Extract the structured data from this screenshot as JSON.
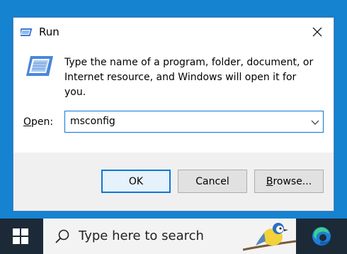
{
  "dialog": {
    "title": "Run",
    "description": "Type the name of a program, folder, document, or Internet resource, and Windows will open it for you.",
    "open_label_key": "O",
    "open_label_rest": "pen:",
    "open_value": "msconfig",
    "ok_label": "OK",
    "cancel_label": "Cancel",
    "browse_label_key": "B",
    "browse_label_rest": "rowse..."
  },
  "taskbar": {
    "search_placeholder": "Type here to search"
  },
  "icons": {
    "title": "run-icon",
    "close": "close-icon",
    "dropdown": "chevron-down-icon",
    "start": "windows-logo-icon",
    "search": "search-icon",
    "edge": "edge-icon"
  },
  "colors": {
    "accent": "#0b78d7",
    "taskbar": "#1c2a38",
    "desktop": "#1683d1"
  }
}
